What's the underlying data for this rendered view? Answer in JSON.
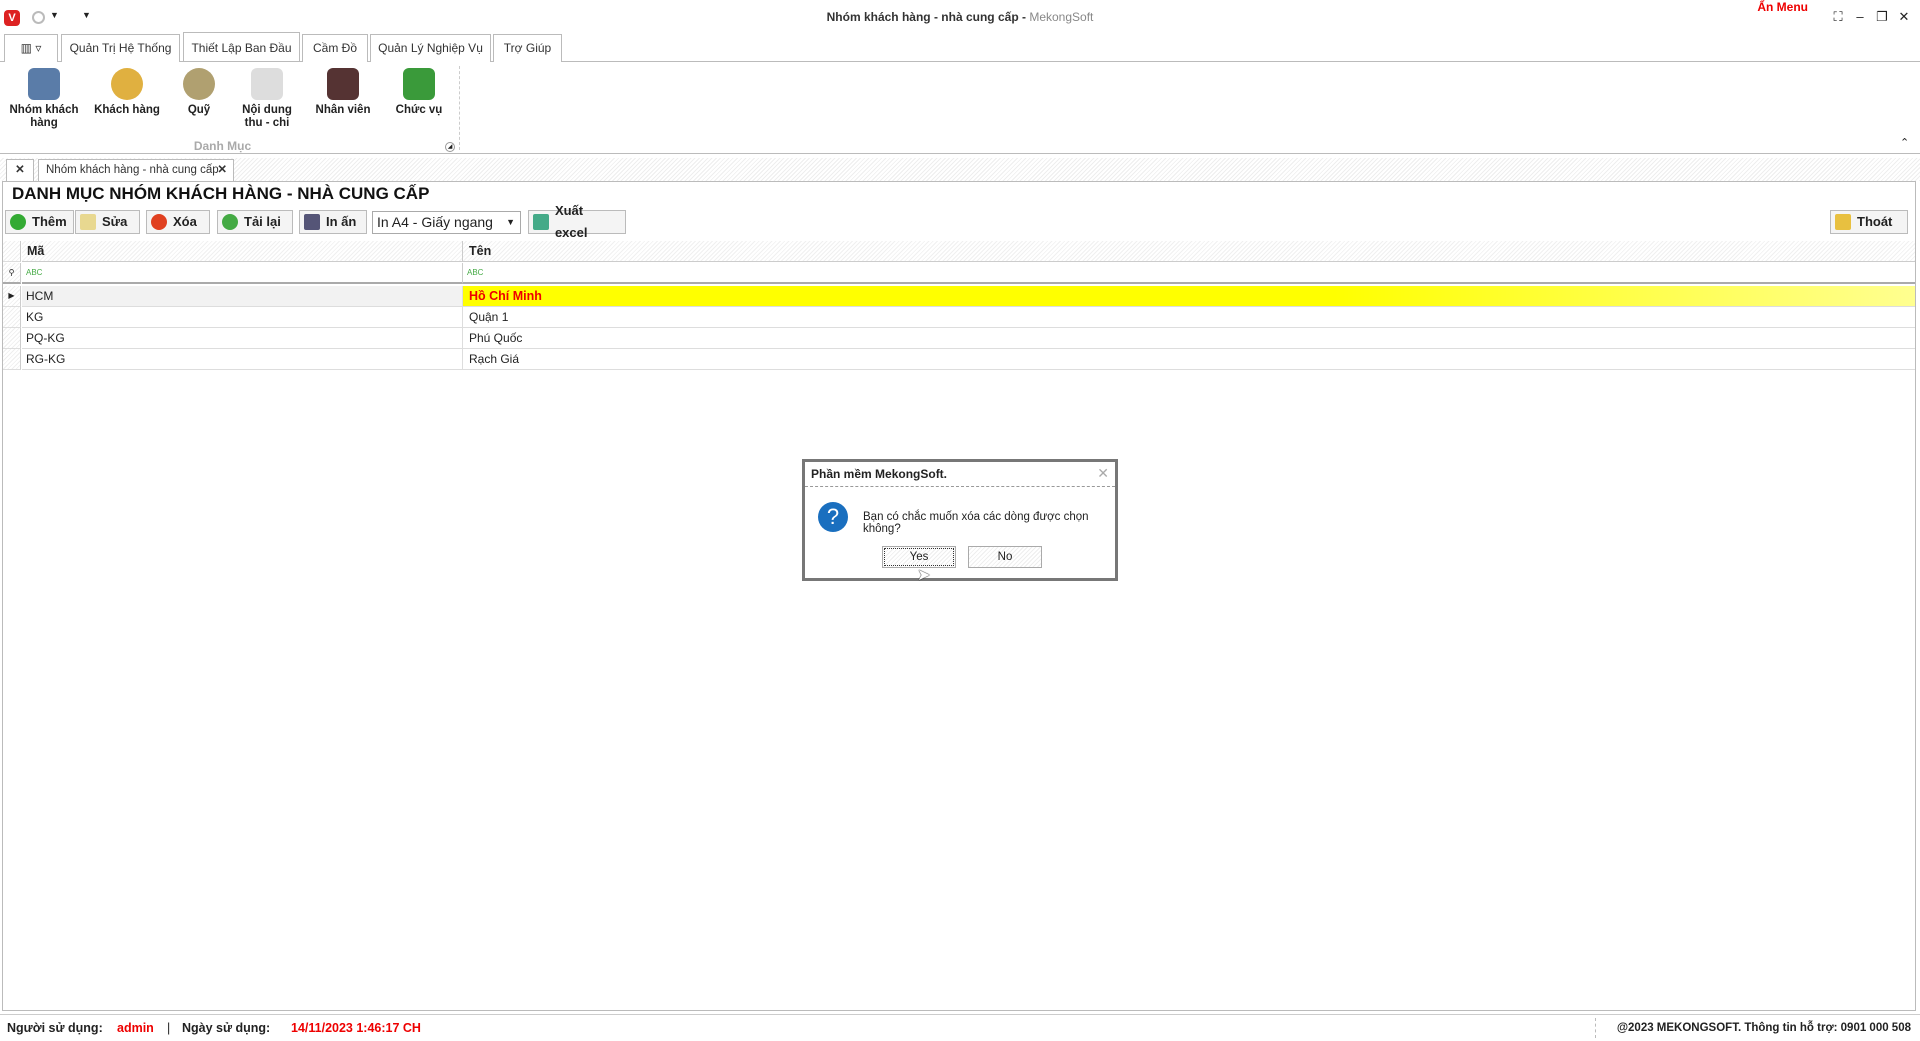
{
  "window": {
    "title": "Nhóm khách hàng - nhà cung cấp",
    "app": "MekongSoft",
    "hide_menu": "Ẩn Menu"
  },
  "ribbon_tabs": [
    "Quản Trị Hệ Thống",
    "Thiết Lập Ban Đầu",
    "Cầm Đồ",
    "Quản Lý Nghiệp Vụ",
    "Trợ Giúp"
  ],
  "ribbon": {
    "group_label": "Danh Mục",
    "buttons": [
      "Nhóm khách hàng",
      "Khách hàng",
      "Quỹ",
      "Nội dung thu - chi",
      "Nhân viên",
      "Chức vụ"
    ]
  },
  "doc_tab": "Nhóm khách hàng - nhà cung cấp",
  "heading": "DANH MỤC NHÓM KHÁCH HÀNG - NHÀ CUNG CẤP",
  "toolbar": {
    "add": "Thêm",
    "edit": "Sửa",
    "delete": "Xóa",
    "reload": "Tải lại",
    "print": "In ấn",
    "print_option": "In A4 - Giấy ngang",
    "export": "Xuất excel",
    "exit": "Thoát"
  },
  "grid": {
    "columns": [
      "Mã",
      "Tên"
    ],
    "filter_icon": "ABC",
    "rows": [
      {
        "ma": "HCM",
        "ten": "Hồ Chí Minh",
        "selected": true
      },
      {
        "ma": "KG",
        "ten": "Quận 1"
      },
      {
        "ma": "PQ-KG",
        "ten": "Phú Quốc"
      },
      {
        "ma": "RG-KG",
        "ten": "Rạch Giá"
      }
    ]
  },
  "dialog": {
    "title": "Phần mềm MekongSoft.",
    "message": "Bạn có chắc muốn xóa các dòng được chọn không?",
    "yes": "Yes",
    "no": "No"
  },
  "status": {
    "user_label": "Người sử dụng:",
    "user": "admin",
    "sep": "|",
    "date_label": "Ngày sử dụng:",
    "date": "14/11/2023 1:46:17 CH",
    "support": "@2023 MEKONGSOFT. Thông tin hỗ trợ: 0901 000 508"
  },
  "colors": {
    "accent_red": "#e00000",
    "highlight": "#ffff00"
  }
}
